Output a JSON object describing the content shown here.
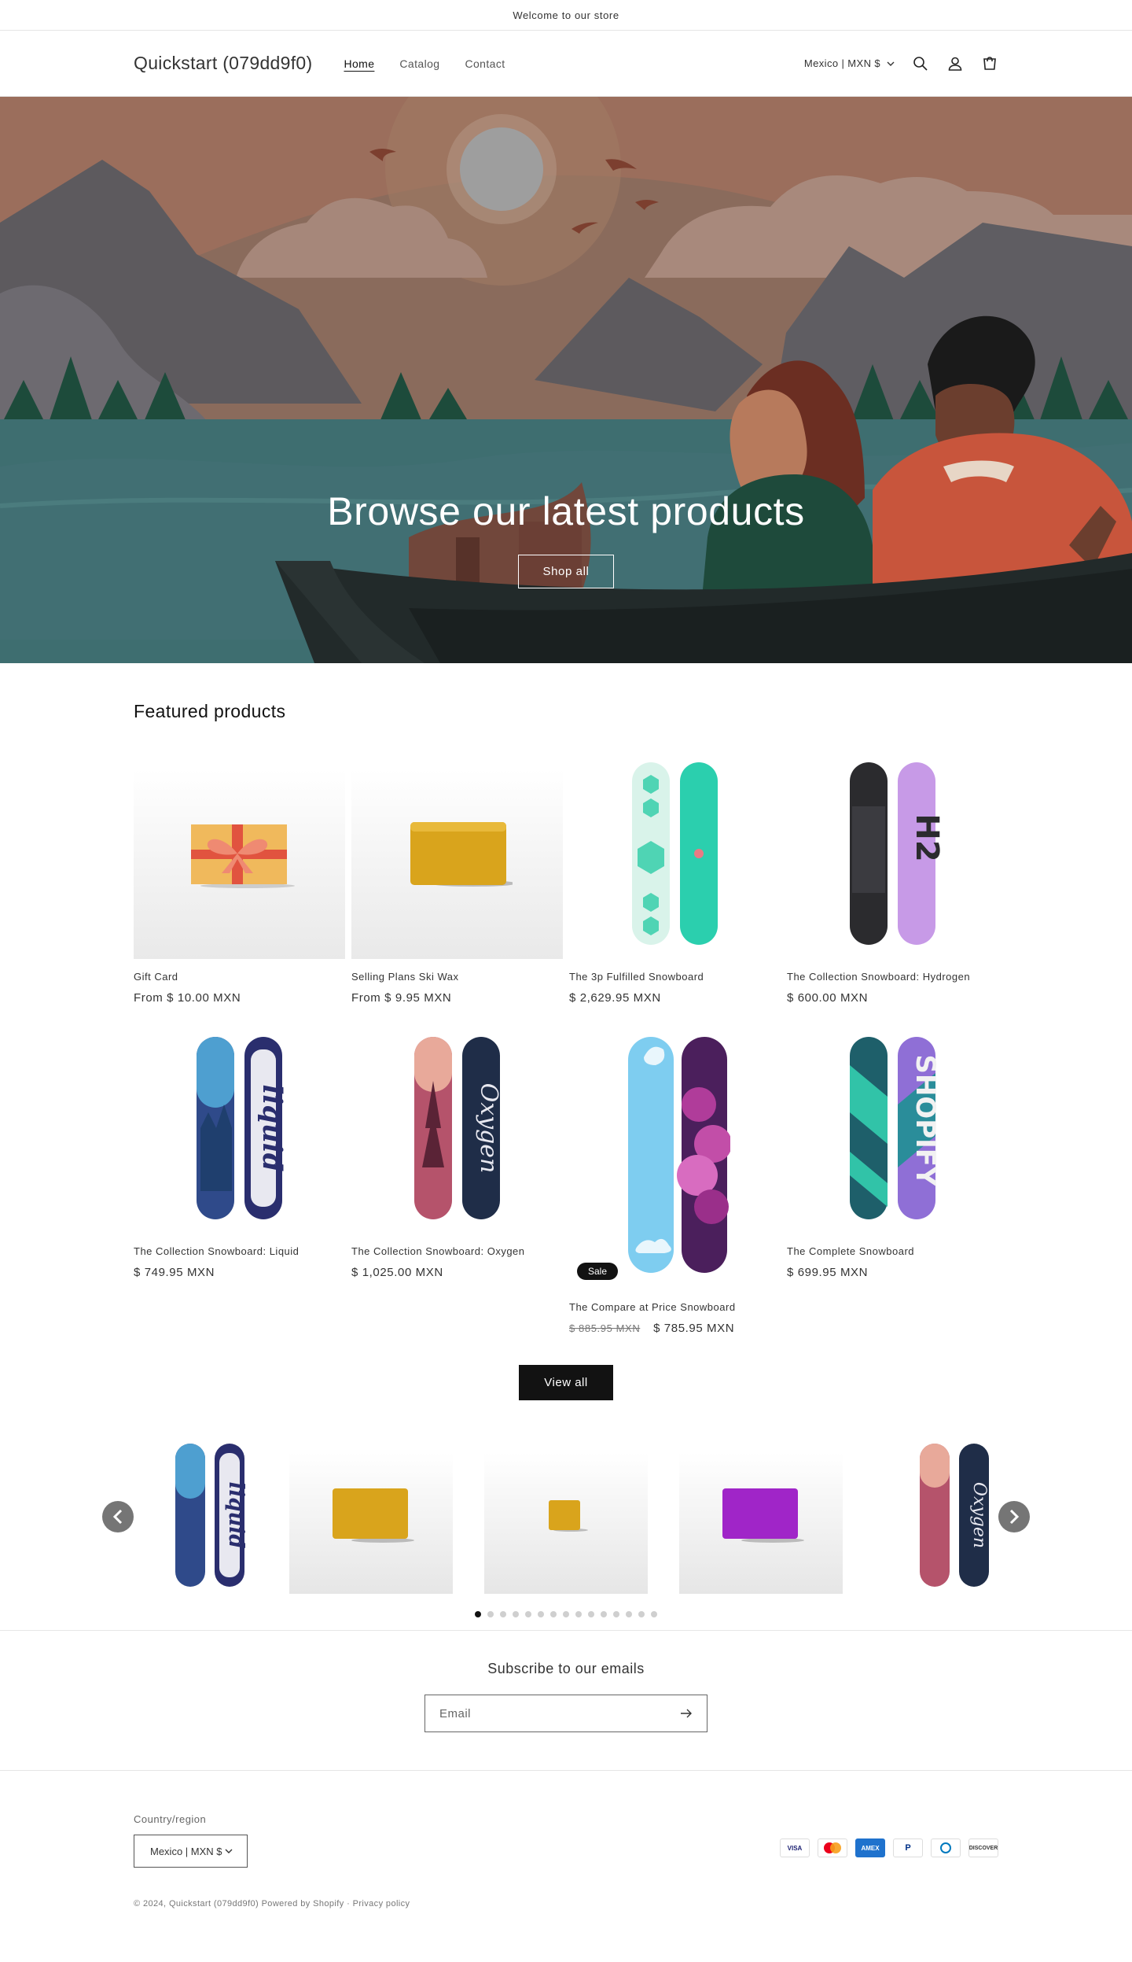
{
  "announcement": "Welcome to our store",
  "header": {
    "logo": "Quickstart (079dd9f0)",
    "nav": [
      "Home",
      "Catalog",
      "Contact"
    ],
    "locale": "Mexico | MXN $"
  },
  "hero": {
    "title": "Browse our latest products",
    "button": "Shop all"
  },
  "featured": {
    "title": "Featured products",
    "products": [
      {
        "title": "Gift Card",
        "price": "From $ 10.00 MXN"
      },
      {
        "title": "Selling Plans Ski Wax",
        "price": "From $ 9.95 MXN"
      },
      {
        "title": "The 3p Fulfilled Snowboard",
        "price": "$ 2,629.95 MXN"
      },
      {
        "title": "The Collection Snowboard: Hydrogen",
        "price": "$ 600.00 MXN"
      },
      {
        "title": "The Collection Snowboard: Liquid",
        "price": "$ 749.95 MXN"
      },
      {
        "title": "The Collection Snowboard: Oxygen",
        "price": "$ 1,025.00 MXN"
      },
      {
        "title": "The Compare at Price Snowboard",
        "old_price": "$ 885.95 MXN",
        "price": "$ 785.95 MXN",
        "badge": "Sale"
      },
      {
        "title": "The Complete Snowboard",
        "price": "$ 699.95 MXN"
      }
    ],
    "view_all": "View all"
  },
  "carousel": {
    "dot_count": 15,
    "active_dot": 0
  },
  "newsletter": {
    "title": "Subscribe to our emails",
    "placeholder": "Email"
  },
  "footer": {
    "country_label": "Country/region",
    "country_value": "Mexico | MXN $",
    "payments": [
      "VISA",
      "Mastercard",
      "AMEX",
      "PayPal",
      "Diners",
      "DISCOVER"
    ],
    "copyright": "© 2024, Quickstart (079dd9f0) Powered by Shopify",
    "privacy": "Privacy policy"
  }
}
